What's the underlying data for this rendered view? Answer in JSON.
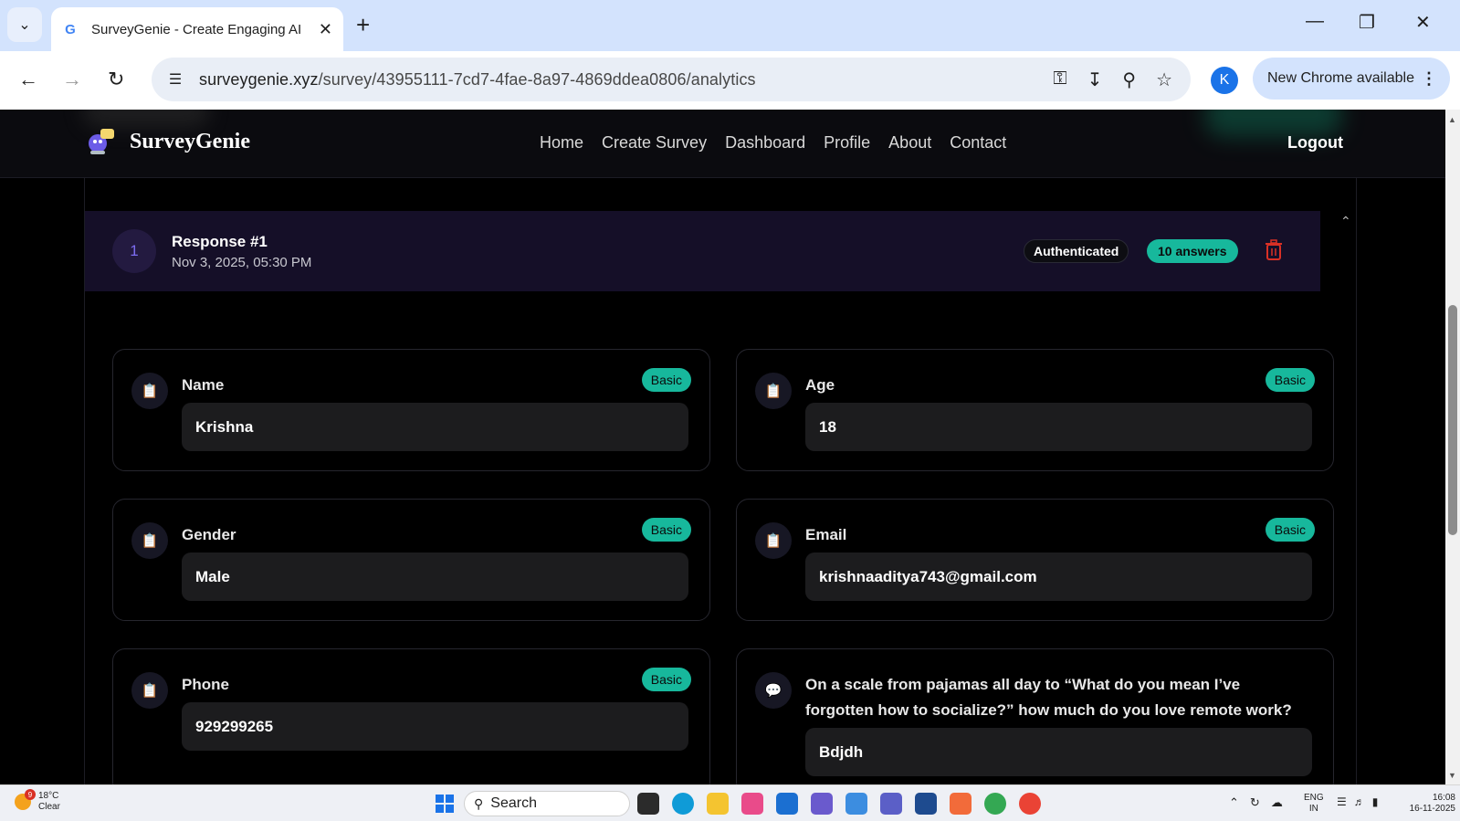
{
  "browser": {
    "tab_title": "SurveyGenie - Create Engaging AI",
    "url_host": "surveygenie.xyz",
    "url_path": "/survey/43955111-7cd7-4fae-8a97-4869ddea0806/analytics",
    "profile_initial": "K",
    "update_label": "New Chrome available"
  },
  "site": {
    "brand": "SurveyGenie",
    "nav": [
      "Home",
      "Create Survey",
      "Dashboard",
      "Profile",
      "About",
      "Contact"
    ],
    "logout": "Logout"
  },
  "response": {
    "number": "1",
    "title": "Response #1",
    "date": "Nov 3, 2025, 05:30 PM",
    "auth_badge": "Authenticated",
    "count_badge": "10 answers"
  },
  "cards": [
    {
      "question": "Name",
      "type": "Basic",
      "answer": "Krishna",
      "icon": "clipboard-icon"
    },
    {
      "question": "Age",
      "type": "Basic",
      "answer": "18",
      "icon": "clipboard-icon"
    },
    {
      "question": "Gender",
      "type": "Basic",
      "answer": "Male",
      "icon": "clipboard-icon"
    },
    {
      "question": "Email",
      "type": "Basic",
      "answer": "krishnaaditya743@gmail.com",
      "icon": "clipboard-icon"
    },
    {
      "question": "Phone",
      "type": "Basic",
      "answer": "929299265",
      "icon": "clipboard-icon"
    },
    {
      "question": "On a scale from pajamas all day to “What do you mean I’ve forgotten how to socialize?” how much do you love remote work?",
      "type": "",
      "answer": "Bdjdh",
      "icon": "speech-bubble-icon"
    }
  ],
  "taskbar": {
    "weather_temp": "18°C",
    "weather_desc": "Clear",
    "weather_alert": "9",
    "search_label": "Search",
    "lang_1": "ENG",
    "lang_2": "IN",
    "time": "16:08",
    "date": "16-11-2025"
  },
  "colors": {
    "accent_teal": "#17b89c",
    "response_header_bg": "#150f28",
    "delete_red": "#d93025"
  }
}
